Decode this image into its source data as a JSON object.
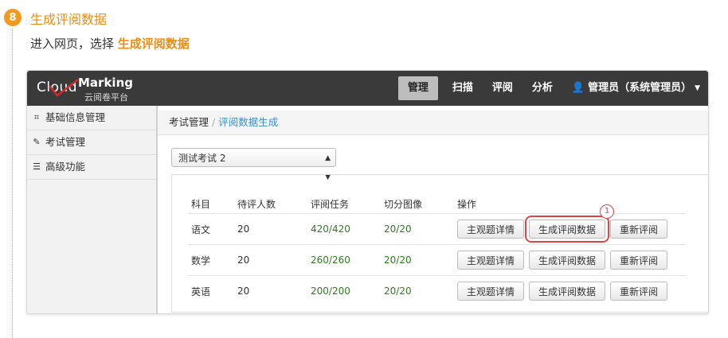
{
  "step": {
    "number": "8",
    "title": "生成评阅数据",
    "description_prefix": "进入网页，选择 ",
    "description_highlight": "生成评阅数据"
  },
  "brand": {
    "name_cloud": "Cloud",
    "name_marking": "Marking",
    "subtitle": "云阅卷平台"
  },
  "nav": {
    "items": [
      "管理",
      "扫描",
      "评阅",
      "分析"
    ],
    "active": "管理",
    "user": "管理员（系统管理员）"
  },
  "sidebar": {
    "items": [
      {
        "label": "基础信息管理",
        "icon": "sitemap-icon"
      },
      {
        "label": "考试管理",
        "icon": "edit-icon"
      },
      {
        "label": "高级功能",
        "icon": "list-icon"
      }
    ]
  },
  "breadcrumb": {
    "parent": "考试管理",
    "current": "评阅数据生成"
  },
  "exam_select": {
    "value": "测试考试 2"
  },
  "table": {
    "headers": [
      "科目",
      "待评人数",
      "评阅任务",
      "切分图像",
      "操作"
    ],
    "rows": [
      {
        "subject": "语文",
        "pending": "20",
        "tasks": "420/420",
        "images": "20/20"
      },
      {
        "subject": "数学",
        "pending": "20",
        "tasks": "260/260",
        "images": "20/20"
      },
      {
        "subject": "英语",
        "pending": "20",
        "tasks": "200/200",
        "images": "20/20"
      }
    ],
    "actions": [
      "主观题详情",
      "生成评阅数据",
      "重新评阅"
    ]
  },
  "callout": {
    "number": "1"
  },
  "colors": {
    "accent_orange": "#f39a1e",
    "highlight_red": "#e04545",
    "green_value": "#2e7d1e",
    "navbar": "#3a3a3a"
  }
}
